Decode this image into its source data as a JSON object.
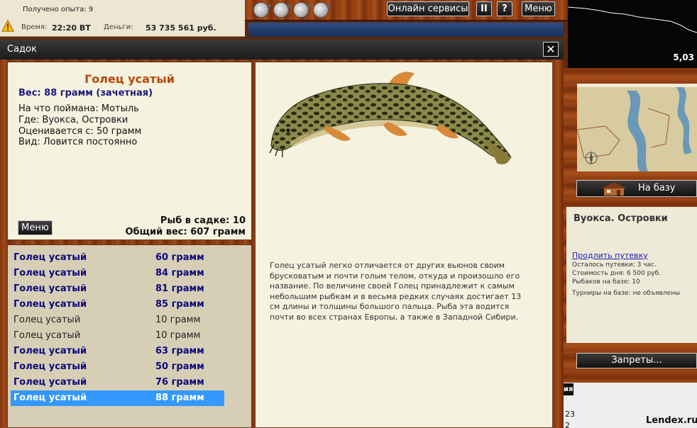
{
  "status": {
    "experience": "Получено опыта: 9",
    "time_label": "Время:",
    "time_value": "22:20 ВТ",
    "money_label": "Деньги:",
    "money_value": "53 735 561 руб."
  },
  "topbar": {
    "online_services": "Онлайн сервисы",
    "pause": "II",
    "help": "?",
    "menu": "Меню"
  },
  "graph": {
    "value": "5,03"
  },
  "right_panel": {
    "to_base": "На базу",
    "location_title": "Вуокса. Островки",
    "extend_link": "Продлить путевку",
    "info_lines": [
      "Осталось путевки: 3 час.",
      "Стоимость дня: 6 500 руб.",
      "Рыбаков на базе: 10",
      "",
      "Турниры на базе: не объявлены"
    ],
    "bans": "Запреты...",
    "tab_stub": "ия",
    "num1": "23",
    "num2": "2"
  },
  "watermark": "Lendex.ru",
  "dialog": {
    "title": "Садок",
    "close": "✕",
    "fish": {
      "name": "Голец усатый",
      "weight": "Вес: 88 грамм (зачетная)",
      "caught_on": "На что поймана: Мотыль",
      "where": "Где: Вуокса, Островки",
      "rated_from": "Оценивается с: 50 грамм",
      "kind": "Вид: Ловится постоянно"
    },
    "menu_button": "Меню",
    "fish_count": "Рыб в садке: 10",
    "total_weight": "Общий вес: 607 грамм",
    "list": [
      {
        "name": "Голец усатый",
        "weight": "60 грамм",
        "style": "counted"
      },
      {
        "name": "Голец усатый",
        "weight": "84 грамм",
        "style": "counted"
      },
      {
        "name": "Голец усатый",
        "weight": "81 грамм",
        "style": "counted"
      },
      {
        "name": "Голец усатый",
        "weight": "85 грамм",
        "style": "counted"
      },
      {
        "name": "Голец усатый",
        "weight": "10 грамм",
        "style": "plain"
      },
      {
        "name": "Голец усатый",
        "weight": "10 грамм",
        "style": "plain"
      },
      {
        "name": "Голец усатый",
        "weight": "63 грамм",
        "style": "counted"
      },
      {
        "name": "Голец усатый",
        "weight": "50 грамм",
        "style": "counted"
      },
      {
        "name": "Голец усатый",
        "weight": "76 грамм",
        "style": "counted"
      },
      {
        "name": "Голец усатый",
        "weight": "88 грамм",
        "style": "selected"
      }
    ],
    "description": "Голец усатый легко отличается от других вьюнов своим брусковатым и почти голым телом, откуда и произошло его название. По величине своей Голец принадлежит к самым небольшим рыбкам и в весьма редких случаях достигает 13 см длины и толщины большого пальца. Рыба эта водится почти во всех странах Европы, а также в Западной Сибири."
  }
}
